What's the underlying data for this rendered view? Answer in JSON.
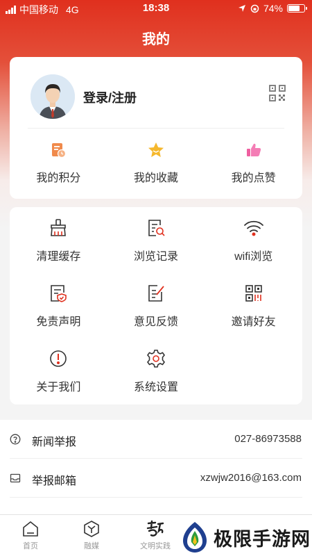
{
  "status_bar": {
    "carrier": "中国移动",
    "network": "4G",
    "time": "18:38",
    "battery": "74%",
    "battery_level": 0.74
  },
  "page_title": "我的",
  "profile": {
    "login_label": "登录/注册",
    "avatar_icon": "user-avatar",
    "qr_icon": "qr-code-icon"
  },
  "quick_actions": [
    {
      "label": "我的积分",
      "icon": "points-icon",
      "color": "#f08a4b"
    },
    {
      "label": "我的收藏",
      "icon": "star-icon",
      "color": "#f5b82e"
    },
    {
      "label": "我的点赞",
      "icon": "thumbs-up-icon",
      "color": "#ef5fa0"
    }
  ],
  "tools": [
    {
      "label": "清理缓存",
      "icon": "broom-icon"
    },
    {
      "label": "浏览记录",
      "icon": "history-icon"
    },
    {
      "label": "wifi浏览",
      "icon": "wifi-icon"
    },
    {
      "label": "免责声明",
      "icon": "disclaimer-icon"
    },
    {
      "label": "意见反馈",
      "icon": "feedback-icon"
    },
    {
      "label": "邀请好友",
      "icon": "invite-qr-icon"
    },
    {
      "label": "关于我们",
      "icon": "info-icon"
    },
    {
      "label": "系统设置",
      "icon": "settings-icon"
    }
  ],
  "report": [
    {
      "label": "新闻举报",
      "value": "027-86973588",
      "icon": "report-icon"
    },
    {
      "label": "举报邮箱",
      "value": "xzwjw2016@163.com",
      "icon": "mail-icon"
    }
  ],
  "tabs": [
    {
      "label": "首页",
      "icon": "home-icon"
    },
    {
      "label": "融媒",
      "icon": "media-icon"
    },
    {
      "label": "文明实践",
      "icon": "civilization-icon"
    }
  ],
  "watermark": {
    "text": "极限手游网"
  },
  "colors": {
    "accent": "#e0301e",
    "icon_dark": "#333333",
    "icon_red": "#e0301e"
  }
}
